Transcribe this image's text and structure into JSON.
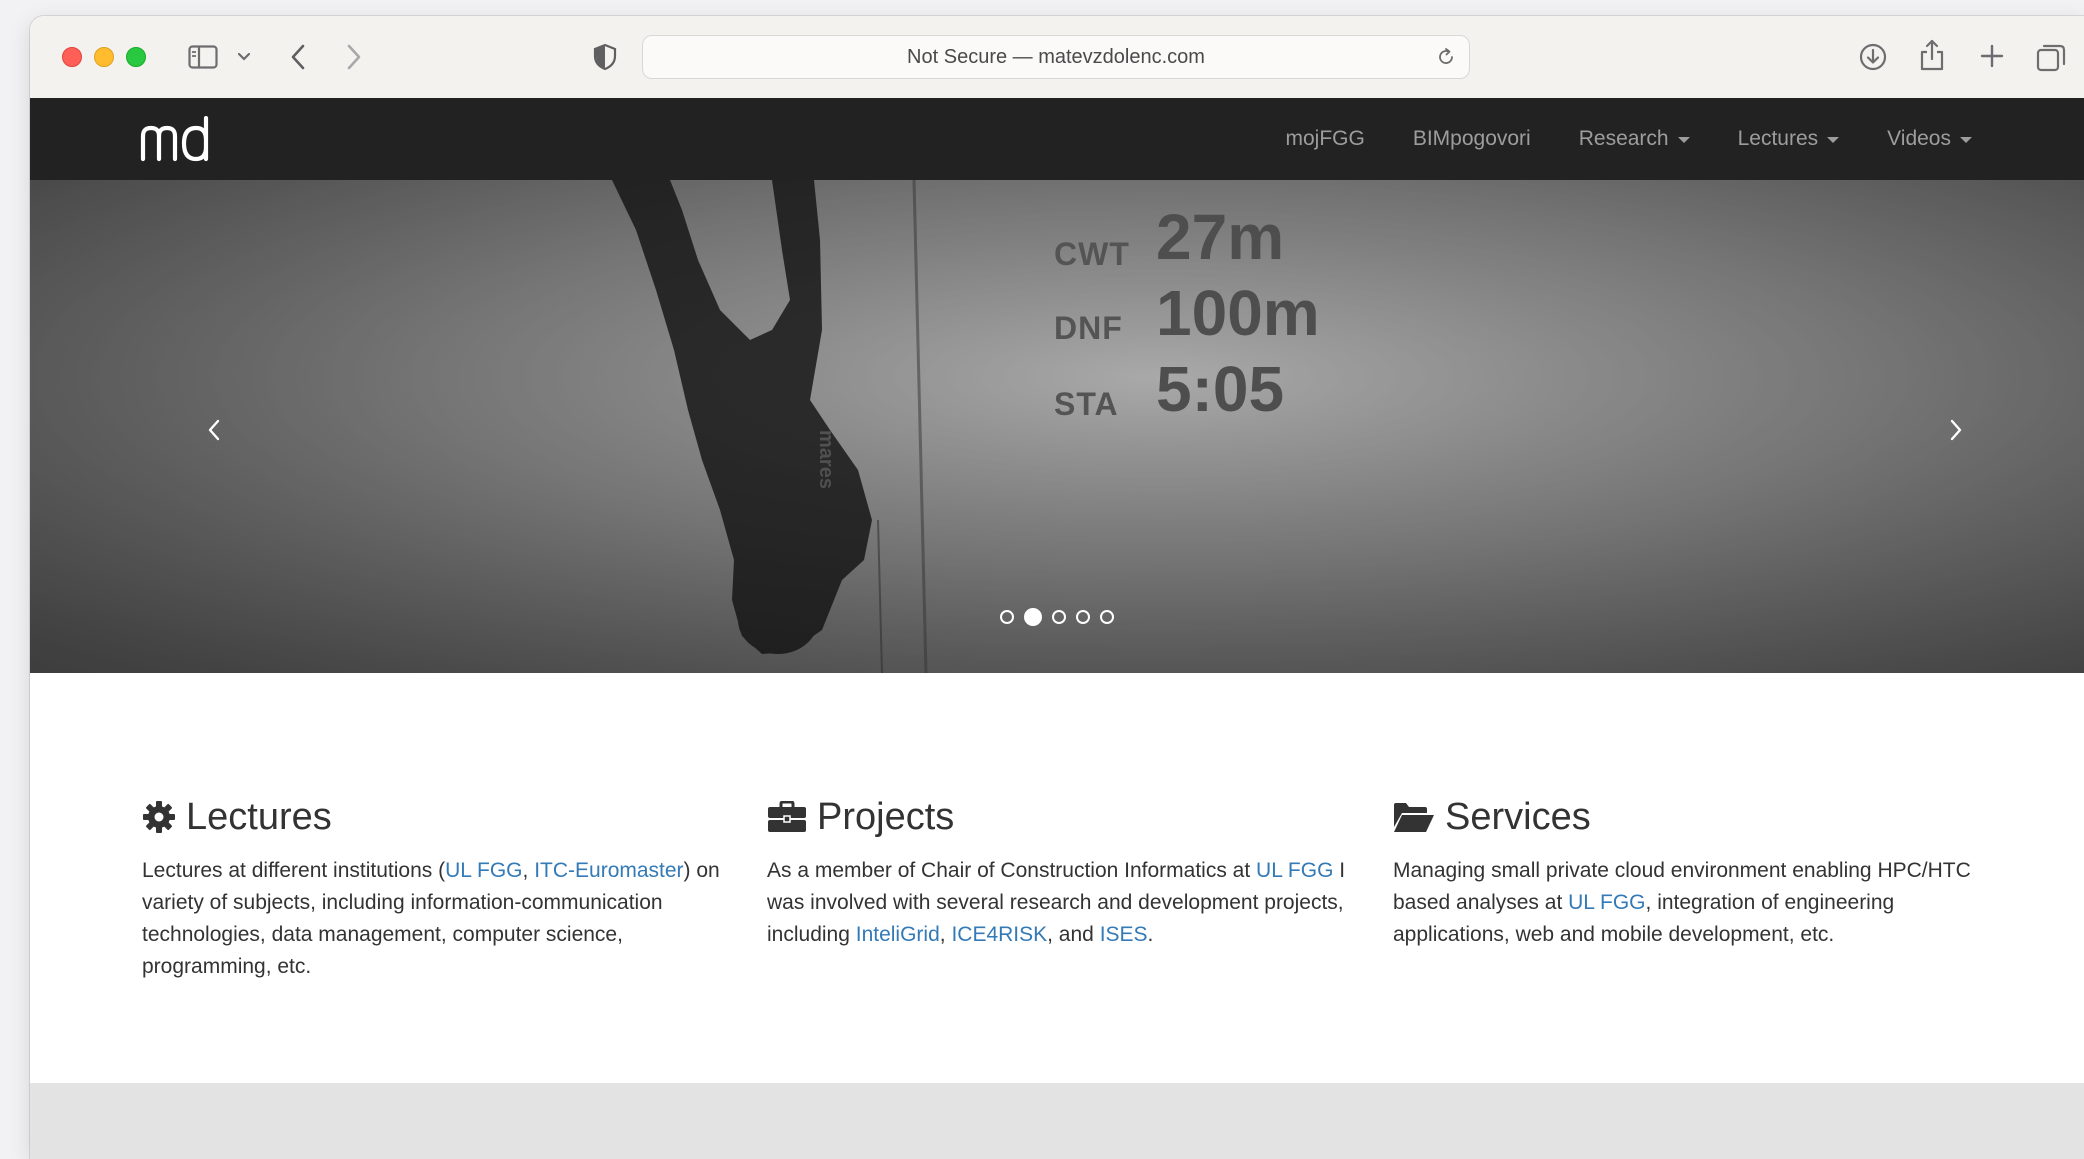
{
  "browser": {
    "url_text": "Not Secure — matevzdolenc.com"
  },
  "site": {
    "logo_text": "md",
    "nav": [
      {
        "label": "mojFGG",
        "dropdown": false
      },
      {
        "label": "BIMpogovori",
        "dropdown": false
      },
      {
        "label": "Research",
        "dropdown": true
      },
      {
        "label": "Lectures",
        "dropdown": true
      },
      {
        "label": "Videos",
        "dropdown": true
      }
    ]
  },
  "carousel": {
    "slide": {
      "rows": [
        {
          "label": "CWT",
          "value": "27m"
        },
        {
          "label": "DNF",
          "value": "100m"
        },
        {
          "label": "STA",
          "value": "5:05"
        }
      ],
      "wetsuit_brand": "mares"
    },
    "slide_count": 5,
    "active_index": 1
  },
  "features": {
    "lectures": {
      "title": "Lectures",
      "icon": "gear-icon",
      "t1": "Lectures at different institutions (",
      "l1": "UL FGG",
      "t2": ", ",
      "l2": "ITC-Euromaster",
      "t3": ") on variety of subjects, including information-communication technologies, data management, computer science, programming, etc."
    },
    "projects": {
      "title": "Projects",
      "icon": "briefcase-icon",
      "t1": "As a member of Chair of Construction Informatics at ",
      "l1": "UL FGG",
      "t2": " I was involved with several research and development projects, including ",
      "l2": "InteliGrid",
      "t3": ", ",
      "l3": "ICE4RISK",
      "t4": ", and ",
      "l4": "ISES",
      "t5": "."
    },
    "services": {
      "title": "Services",
      "icon": "folder-open-icon",
      "t1": "Managing small private cloud environment enabling HPC/HTC based analyses at ",
      "l1": "UL FGG",
      "t2": ", integration of engineering applications, web and mobile development, etc."
    }
  },
  "colors": {
    "nav_bg": "#222222",
    "nav_text": "#9d9d9d",
    "link": "#337ab7",
    "body_text": "#333333"
  }
}
